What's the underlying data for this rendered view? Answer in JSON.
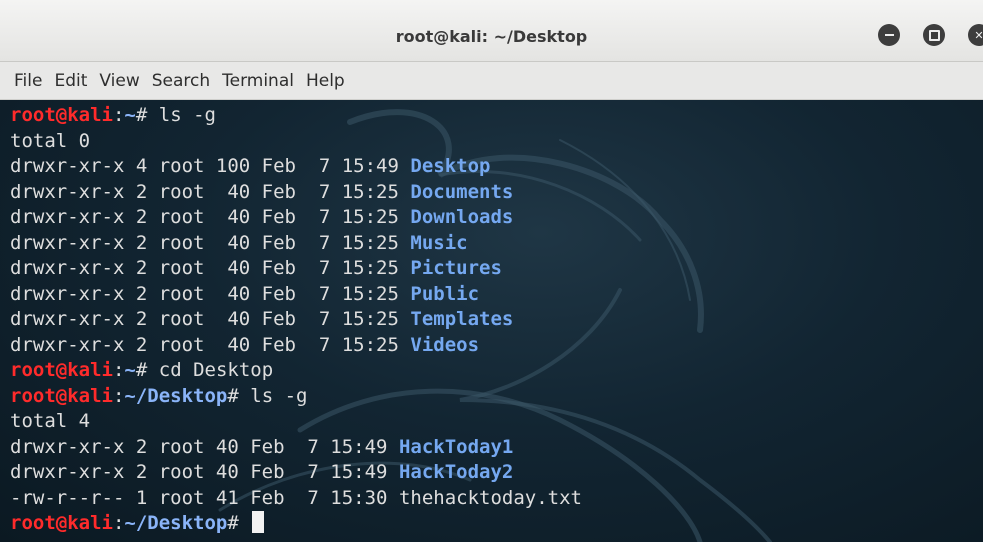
{
  "window": {
    "title": "root@kali: ~/Desktop"
  },
  "menubar": {
    "items": [
      "File",
      "Edit",
      "View",
      "Search",
      "Terminal",
      "Help"
    ]
  },
  "terminal": {
    "lines": [
      {
        "type": "prompt",
        "user": "root@kali",
        "sep": ":",
        "path": "~",
        "symbol": "# ",
        "cmd": "ls -g"
      },
      {
        "type": "text",
        "text": "total 0"
      },
      {
        "type": "entry",
        "meta": "drwxr-xr-x 4 root 100 Feb  7 15:49 ",
        "name": "Desktop",
        "isdir": true
      },
      {
        "type": "entry",
        "meta": "drwxr-xr-x 2 root  40 Feb  7 15:25 ",
        "name": "Documents",
        "isdir": true
      },
      {
        "type": "entry",
        "meta": "drwxr-xr-x 2 root  40 Feb  7 15:25 ",
        "name": "Downloads",
        "isdir": true
      },
      {
        "type": "entry",
        "meta": "drwxr-xr-x 2 root  40 Feb  7 15:25 ",
        "name": "Music",
        "isdir": true
      },
      {
        "type": "entry",
        "meta": "drwxr-xr-x 2 root  40 Feb  7 15:25 ",
        "name": "Pictures",
        "isdir": true
      },
      {
        "type": "entry",
        "meta": "drwxr-xr-x 2 root  40 Feb  7 15:25 ",
        "name": "Public",
        "isdir": true
      },
      {
        "type": "entry",
        "meta": "drwxr-xr-x 2 root  40 Feb  7 15:25 ",
        "name": "Templates",
        "isdir": true
      },
      {
        "type": "entry",
        "meta": "drwxr-xr-x 2 root  40 Feb  7 15:25 ",
        "name": "Videos",
        "isdir": true
      },
      {
        "type": "prompt",
        "user": "root@kali",
        "sep": ":",
        "path": "~",
        "symbol": "# ",
        "cmd": "cd Desktop"
      },
      {
        "type": "prompt",
        "user": "root@kali",
        "sep": ":",
        "path": "~/Desktop",
        "symbol": "# ",
        "cmd": "ls -g"
      },
      {
        "type": "text",
        "text": "total 4"
      },
      {
        "type": "entry",
        "meta": "drwxr-xr-x 2 root 40 Feb  7 15:49 ",
        "name": "HackToday1",
        "isdir": true
      },
      {
        "type": "entry",
        "meta": "drwxr-xr-x 2 root 40 Feb  7 15:49 ",
        "name": "HackToday2",
        "isdir": true
      },
      {
        "type": "entry",
        "meta": "-rw-r--r-- 1 root 41 Feb  7 15:30 ",
        "name": "thehacktoday.txt",
        "isdir": false
      },
      {
        "type": "prompt",
        "user": "root@kali",
        "sep": ":",
        "path": "~/Desktop",
        "symbol": "# ",
        "cmd": "",
        "cursor": true
      }
    ]
  },
  "colors": {
    "user": "#ff2b2b",
    "path": "#8ab4f8",
    "directory": "#75a8f0",
    "text": "#dedede",
    "background": "#122532"
  }
}
